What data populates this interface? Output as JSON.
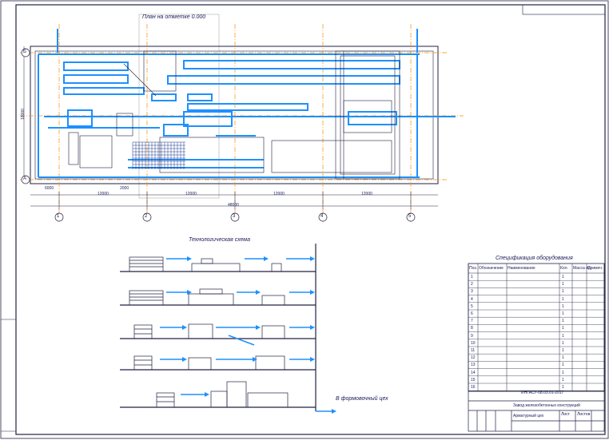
{
  "drawing": {
    "plan_title": "План на отметке 0.000",
    "scheme_title": "Технологическая схема",
    "spec_title": "Спецификация оборудования",
    "exit_label": "В формовочный цех"
  },
  "plan": {
    "grid_axes_bottom": [
      "1",
      "2",
      "3",
      "4",
      "5"
    ],
    "grid_axes_left": [
      "Б",
      "А"
    ],
    "dim_spans": [
      "12000",
      "12000",
      "12000",
      "12000"
    ],
    "dim_total": "48000",
    "dim_depth": "18000",
    "small_dims": [
      "6000",
      "2000",
      "2000",
      "2000",
      "6000"
    ]
  },
  "spec": {
    "headers": [
      "Поз.",
      "Обозначение",
      "Наименование",
      "Кол.",
      "Масса ед.",
      "Примеч."
    ],
    "rows": [
      [
        "1",
        "",
        "",
        "1",
        ""
      ],
      [
        "2",
        "",
        "",
        "1",
        ""
      ],
      [
        "3",
        "",
        "",
        "1",
        ""
      ],
      [
        "4",
        "",
        "",
        "1",
        ""
      ],
      [
        "5",
        "",
        "",
        "1",
        ""
      ],
      [
        "6",
        "",
        "",
        "1",
        ""
      ],
      [
        "7",
        "",
        "",
        "1",
        ""
      ],
      [
        "8",
        "",
        "",
        "1",
        ""
      ],
      [
        "9",
        "",
        "",
        "1",
        ""
      ],
      [
        "10",
        "",
        "",
        "1",
        ""
      ],
      [
        "11",
        "",
        "",
        "1",
        ""
      ],
      [
        "12",
        "",
        "",
        "1",
        ""
      ],
      [
        "13",
        "",
        "",
        "1",
        ""
      ],
      [
        "14",
        "",
        "",
        "1",
        ""
      ],
      [
        "15",
        "",
        "",
        "1",
        ""
      ],
      [
        "16",
        "",
        "",
        "1",
        ""
      ]
    ]
  },
  "title_block": {
    "code": "ИНГАСУ-08.03.01-2017",
    "name": "Завод железобетонных конструкций",
    "sheet_desc": "Арматурный цех",
    "sheet_label": "Лист",
    "sheets_label": "Листов"
  },
  "colors": {
    "line": "#222244",
    "conveyor": "#1e90ff",
    "axis": "#ff8c00",
    "text": "#1a1a5a"
  }
}
